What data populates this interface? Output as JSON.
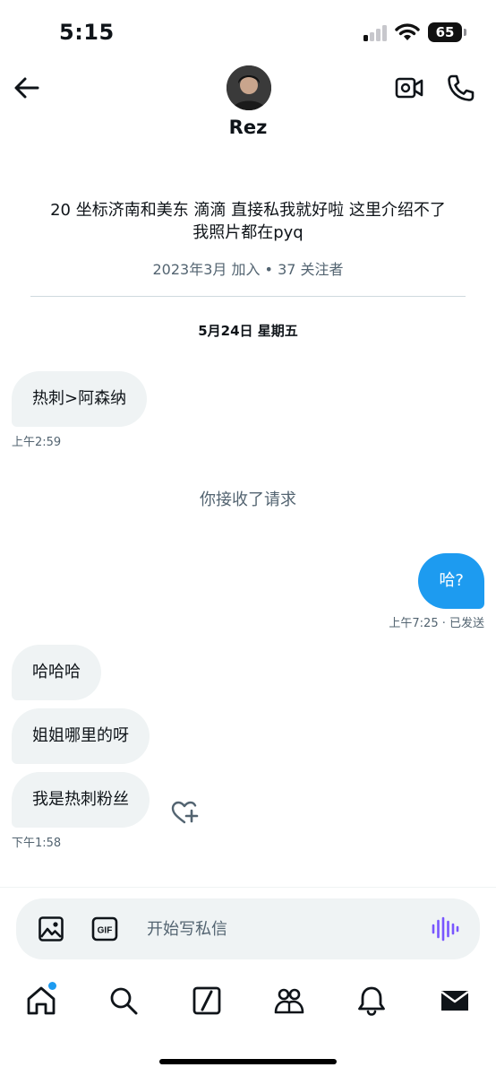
{
  "status_bar": {
    "time": "5:15",
    "battery": "65"
  },
  "header": {
    "name": "Rez",
    "icons": [
      "back-arrow-icon",
      "video-call-icon",
      "phone-icon"
    ]
  },
  "profile": {
    "bio_line1": "20 坐标济南和美东 滴滴 直接私我就好啦 这里介绍不了",
    "bio_line2": "我照片都在pyq",
    "meta": "2023年3月 加入 • 37 关注者"
  },
  "conversation": {
    "date_header": "5月24日 星期五",
    "msg1": {
      "text": "热刺>阿森纳",
      "time": "上午2:59"
    },
    "system_message": "你接收了请求",
    "msg2": {
      "text": "哈?",
      "time": "上午7:25 · 已发送"
    },
    "msg3": {
      "text": "哈哈哈"
    },
    "msg4": {
      "text": "姐姐哪里的呀"
    },
    "msg5": {
      "text": "我是热刺粉丝",
      "time": "下午1:58"
    }
  },
  "composer": {
    "placeholder": "开始写私信",
    "icons": [
      "image-icon",
      "gif-icon",
      "voice-wave-icon"
    ]
  },
  "tab_bar": {
    "tabs": [
      "home-icon",
      "search-icon",
      "grok-icon",
      "communities-icon",
      "notifications-icon",
      "messages-icon"
    ]
  },
  "colors": {
    "accent": "#1d9bf0",
    "incoming_bubble": "#eff3f4",
    "secondary_text": "#536471",
    "voice_icon": "#7856ff"
  }
}
